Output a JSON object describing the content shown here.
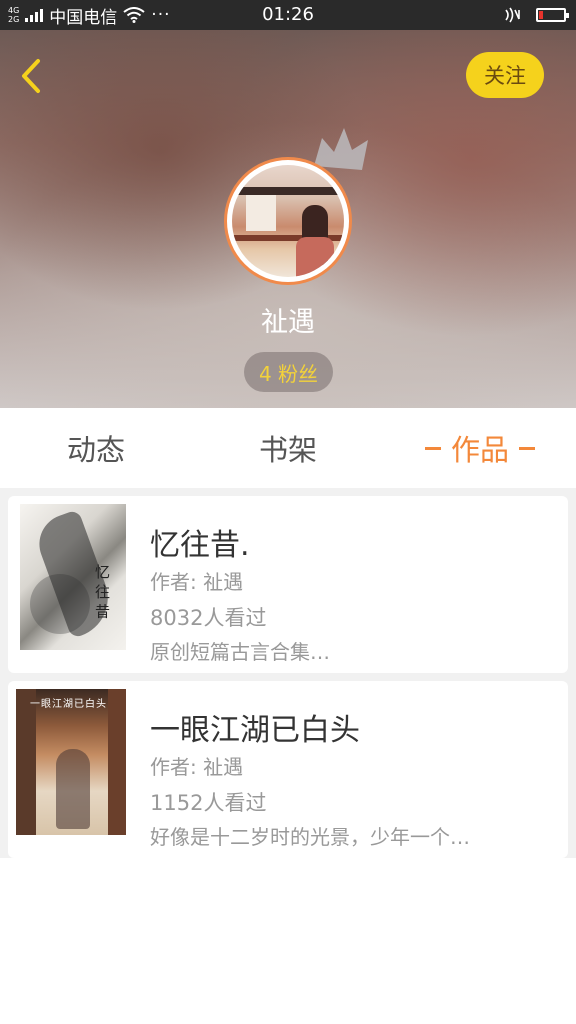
{
  "status_bar": {
    "network": "4G 2G",
    "carrier": "中国电信",
    "dots": "···",
    "time": "01:26"
  },
  "header": {
    "follow_label": "关注",
    "username": "祉遇",
    "fans_label": "4 粉丝"
  },
  "tabs": [
    {
      "label": "动态",
      "active": false
    },
    {
      "label": "书架",
      "active": false
    },
    {
      "label": "作品",
      "active": true
    }
  ],
  "books": [
    {
      "title": "忆往昔.",
      "author": "作者: 祉遇",
      "views": "8032人看过",
      "desc": "原创短篇古言合集…",
      "cover_text": "忆 往 昔"
    },
    {
      "title": "一眼江湖已白头",
      "author": "作者: 祉遇",
      "views": "1152人看过",
      "desc": "好像是十二岁时的光景，少年一个…",
      "cover_text": "一眼江湖已白头"
    }
  ],
  "colors": {
    "accent": "#f3883a",
    "follow_bg": "#f5d21c",
    "fans_text": "#f3d23a",
    "avatar_border": "#f08a4b"
  }
}
